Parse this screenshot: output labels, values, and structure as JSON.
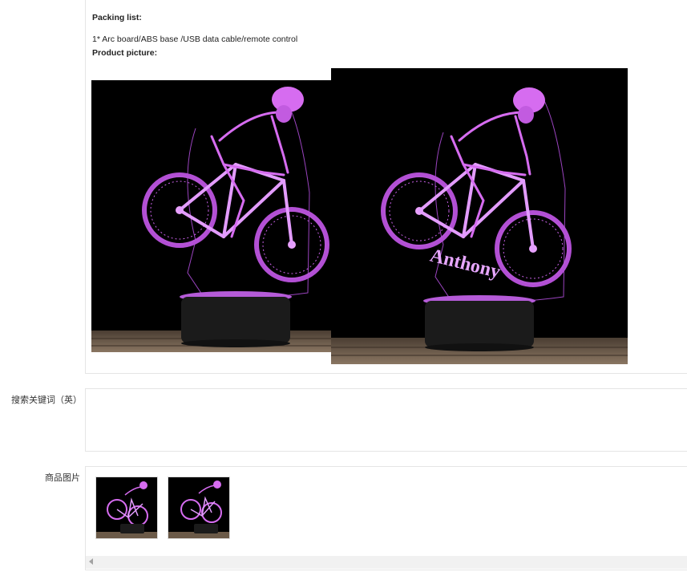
{
  "description": {
    "packing_title": "Packing list:",
    "packing_items": "1* Arc board/ABS base /USB data cable/remote control",
    "picture_title": "Product picture:",
    "photo_overlay_name": "Anthony"
  },
  "fields": {
    "keywords_label": "搜索关键词（英）",
    "keywords_value": "",
    "images_label": "商品图片"
  },
  "colors": {
    "lamp_glow": "#d66cf0",
    "lamp_glow_light": "#f2b6ff",
    "background": "#000000",
    "table_wood": "#6b5a48",
    "panel_border": "#e5e5e5"
  },
  "icons": {
    "scroll_left": "triangle-left"
  }
}
